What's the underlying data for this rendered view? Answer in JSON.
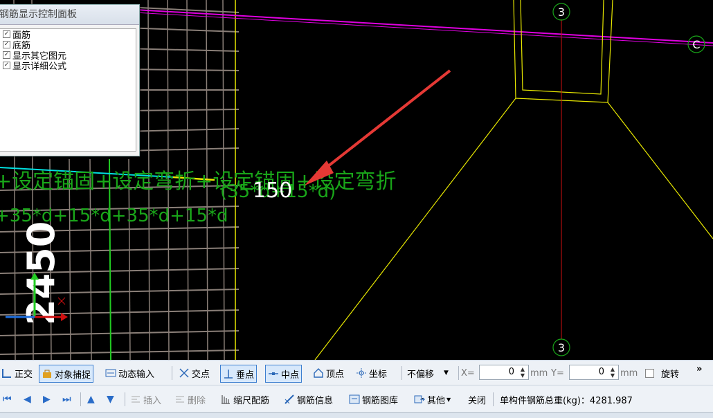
{
  "panel": {
    "title": "钢筋显示控制面板",
    "checkboxes": [
      {
        "label": "面筋",
        "checked": true
      },
      {
        "label": "底筋",
        "checked": true
      },
      {
        "label": "显示其它图元",
        "checked": true
      },
      {
        "label": "显示详细公式",
        "checked": true
      }
    ]
  },
  "drawing": {
    "formula_line1": "+设定锚固+设定弯折+设定锚固+设定弯折",
    "formula_line2": "+35*d+15*d+35*d+15*d",
    "formula_sub": "(35*d+15*d)",
    "dimension_150": "150",
    "dimension_2450": "2450",
    "axis_label_3_top": "3",
    "axis_label_3_bottom": "3",
    "axis_label_c": "C",
    "colors": {
      "magenta_beam": "#e000e0",
      "yellow_outline": "#e8e800",
      "green_text": "#19a519",
      "red_axis": "#d01010",
      "cyan_bar": "#00e0e0",
      "grey_rebar": "#8a7f78",
      "arrow": "#e53935"
    }
  },
  "toolbar1": {
    "ortho": "正交",
    "snap": "对象捕捉",
    "dynamic_input": "动态输入",
    "intersection": "交点",
    "perpendicular": "垂点",
    "midpoint": "中点",
    "vertex": "顶点",
    "coordinate": "坐标",
    "offset_select": "不偏移",
    "x_label": "X=",
    "x_value": "0",
    "x_unit": "mm",
    "y_label": "Y=",
    "y_value": "0",
    "y_unit": "mm",
    "rotate": "旋转",
    "overflow": "»"
  },
  "toolbar2": {
    "insert": "插入",
    "delete": "删除",
    "scale_rebar": "缩尺配筋",
    "rebar_info": "钢筋信息",
    "rebar_library": "钢筋图库",
    "other": "其他",
    "close": "关闭",
    "total_weight": "单构件钢筋总重(kg)：4281.987"
  }
}
